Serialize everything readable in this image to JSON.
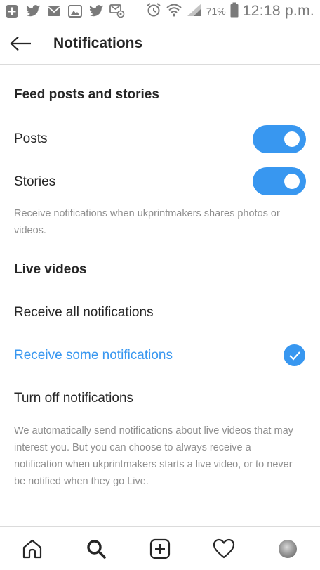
{
  "status_bar": {
    "left_icons": [
      "plus-box-icon",
      "twitter-icon",
      "mail-icon",
      "image-icon",
      "twitter-icon",
      "email-at-icon"
    ],
    "right_icons": [
      "alarm-icon",
      "wifi-icon",
      "signal-icon",
      "battery-icon"
    ],
    "battery_percent": "71%",
    "time": "12:18 p.m."
  },
  "header": {
    "back_icon": "arrow-left-icon",
    "title": "Notifications"
  },
  "feed": {
    "section_title": "Feed posts and stories",
    "posts_label": "Posts",
    "posts_on": true,
    "stories_label": "Stories",
    "stories_on": true,
    "description": "Receive notifications when ukprintmakers shares photos or videos."
  },
  "live": {
    "section_title": "Live videos",
    "options": [
      {
        "label": "Receive all notifications",
        "selected": false
      },
      {
        "label": "Receive some notifications",
        "selected": true
      },
      {
        "label": "Turn off notifications",
        "selected": false
      }
    ],
    "description": "We automatically send notifications about live videos that may interest you. But you can choose to always receive a notification when ukprintmakers starts a live video, or to never be notified when they go Live."
  },
  "bottom_nav": {
    "items": [
      "home-icon",
      "search-icon",
      "new-post-icon",
      "activity-heart-icon",
      "profile-avatar"
    ]
  },
  "colors": {
    "accent": "#3897f0",
    "text": "#262626",
    "muted": "#8e8e8e",
    "divider": "#dbdbdb"
  }
}
